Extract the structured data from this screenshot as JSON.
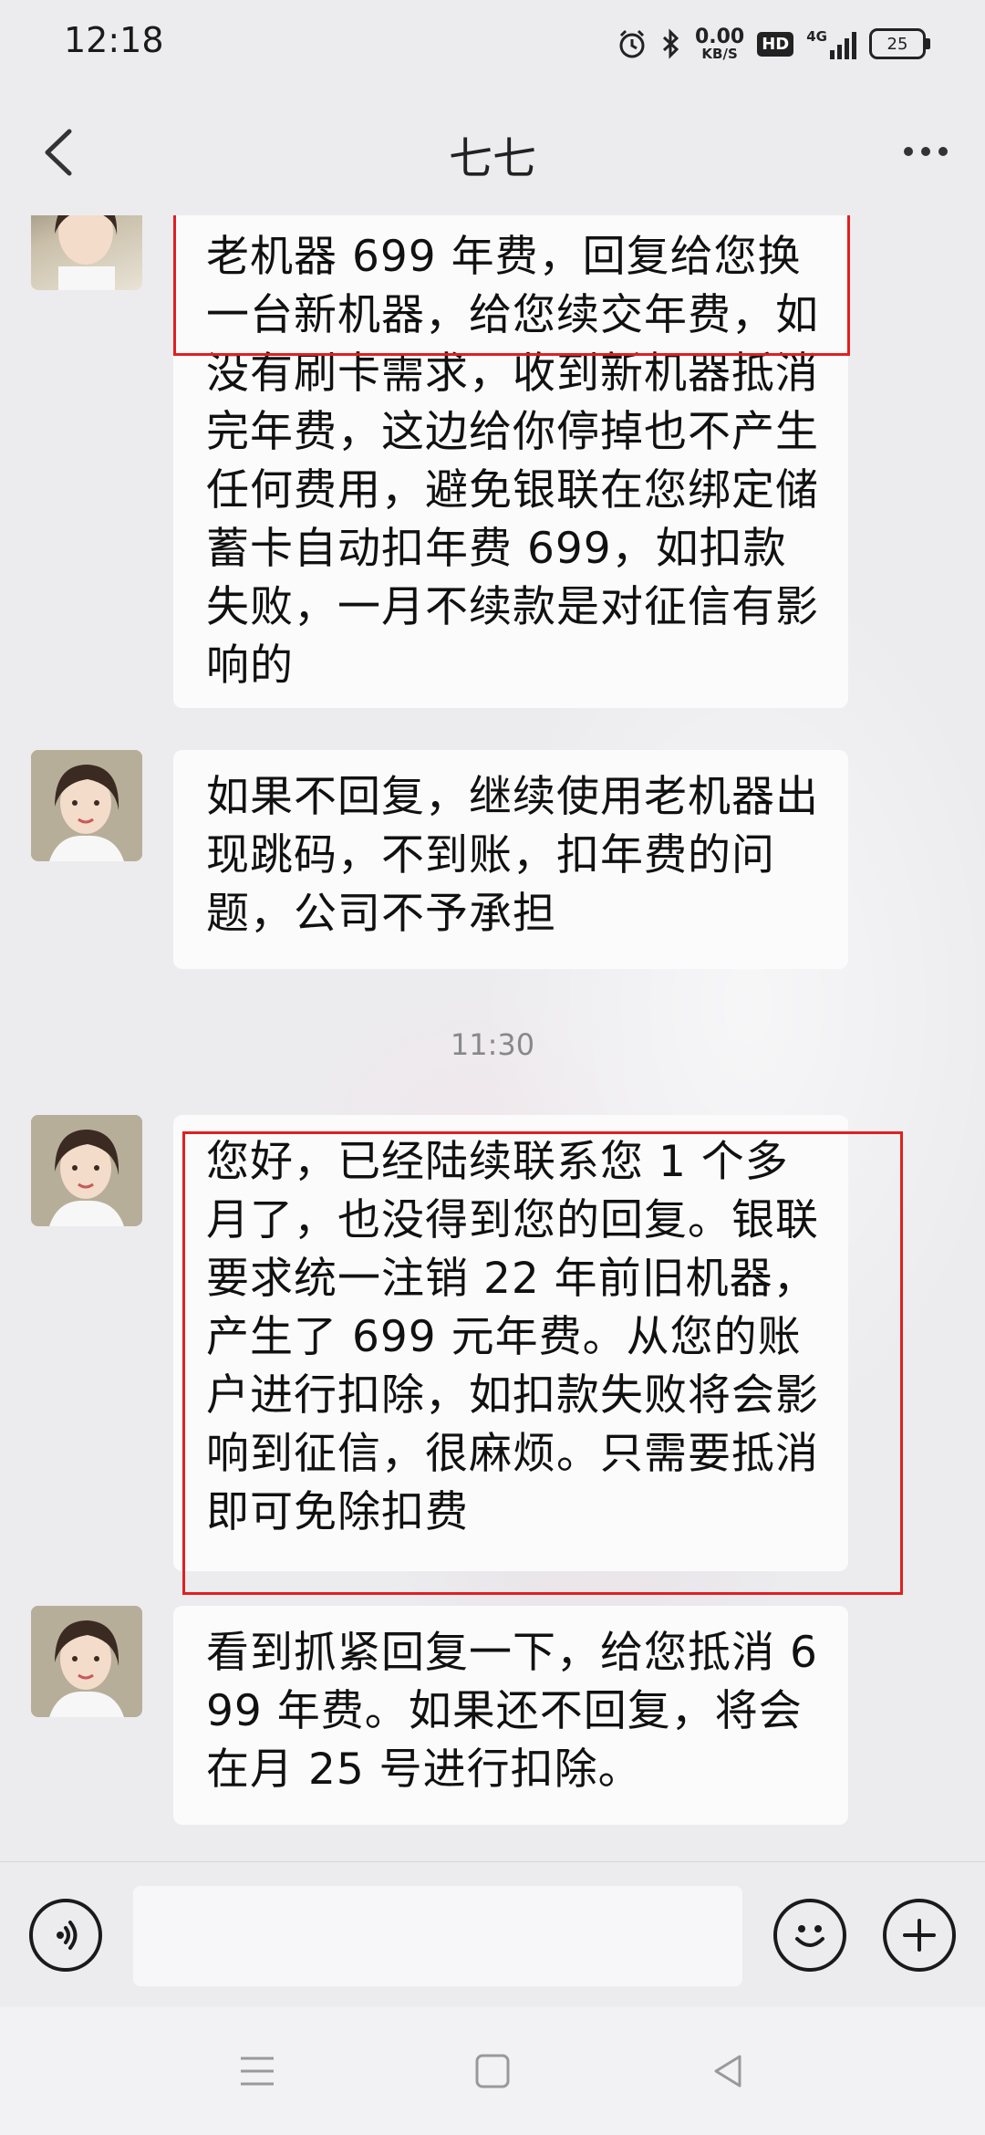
{
  "status_bar": {
    "time": "12:18",
    "net_speed_value": "0.00",
    "net_speed_unit": "KB/S",
    "hd": "HD",
    "network": "4G",
    "battery": "25"
  },
  "header": {
    "title": "七七"
  },
  "messages": [
    {
      "text": "老机器 699 年费，回复给您换一台新机器，给您续交年费，如没有刷卡需求，收到新机器抵消完年费，这边给你停掉也不产生任何费用，避免银联在您绑定储蓄卡自动扣年费 699，如扣款失败，一月不续款是对征信有影响的"
    },
    {
      "text": "如果不回复，继续使用老机器出现跳码，不到账，扣年费的问题，公司不予承担"
    },
    {
      "text": "您好，已经陆续联系您 1 个多月了，也没得到您的回复。银联要求统一注销 22 年前旧机器，产生了 699 元年费。从您的账户进行扣除，如扣款失败将会影响到征信，很麻烦。只需要抵消即可免除扣费"
    },
    {
      "text": "看到抓紧回复一下，给您抵消 699 年费。如果还不回复，将会在月 25 号进行扣除。"
    }
  ],
  "timestamp": "11:30",
  "input": {
    "placeholder": ""
  },
  "colors": {
    "highlight_box": "#e02020",
    "bubble": "#fbfbfc",
    "background": "#ececef"
  },
  "icons": [
    "back-arrow-icon",
    "more-dots-icon",
    "voice-icon",
    "emoji-icon",
    "plus-icon",
    "menu-icon",
    "home-square-icon",
    "back-triangle-icon",
    "alarm-icon",
    "bluetooth-icon",
    "signal-icon",
    "battery-icon"
  ]
}
